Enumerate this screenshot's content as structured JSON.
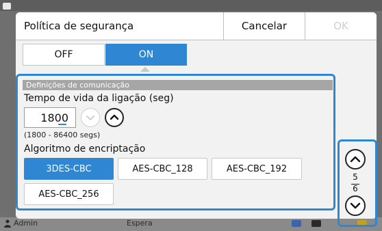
{
  "dialog": {
    "title": "Política de segurança",
    "cancel_label": "Cancelar",
    "ok_label": "OK"
  },
  "toggle": {
    "off_label": "OFF",
    "on_label": "ON",
    "selected": "ON"
  },
  "section": {
    "header": "Definições de comunicação",
    "lifetime_label": "Tempo de vida da ligação (seg)",
    "lifetime_value": "1800",
    "lifetime_range": "(1800 - 86400 segs)",
    "algorithm_label": "Algoritmo de encriptação",
    "algorithms": [
      "3DES-CBC",
      "AES-CBC_128",
      "AES-CBC_192",
      "AES-CBC_256"
    ],
    "selected_algorithm": "3DES-CBC"
  },
  "pager": {
    "current": "5",
    "total": "6"
  },
  "background": {
    "status_left": "Admin",
    "status_center": "Espera"
  },
  "icons": {
    "step_down": "chevron-down-icon",
    "step_up": "chevron-up-icon",
    "page_up": "chevron-up-icon",
    "page_down": "chevron-down-icon"
  },
  "colors": {
    "accent": "#2f86d3",
    "disabled_text": "#cfcfcf",
    "section_bar": "#a6a6a6"
  }
}
